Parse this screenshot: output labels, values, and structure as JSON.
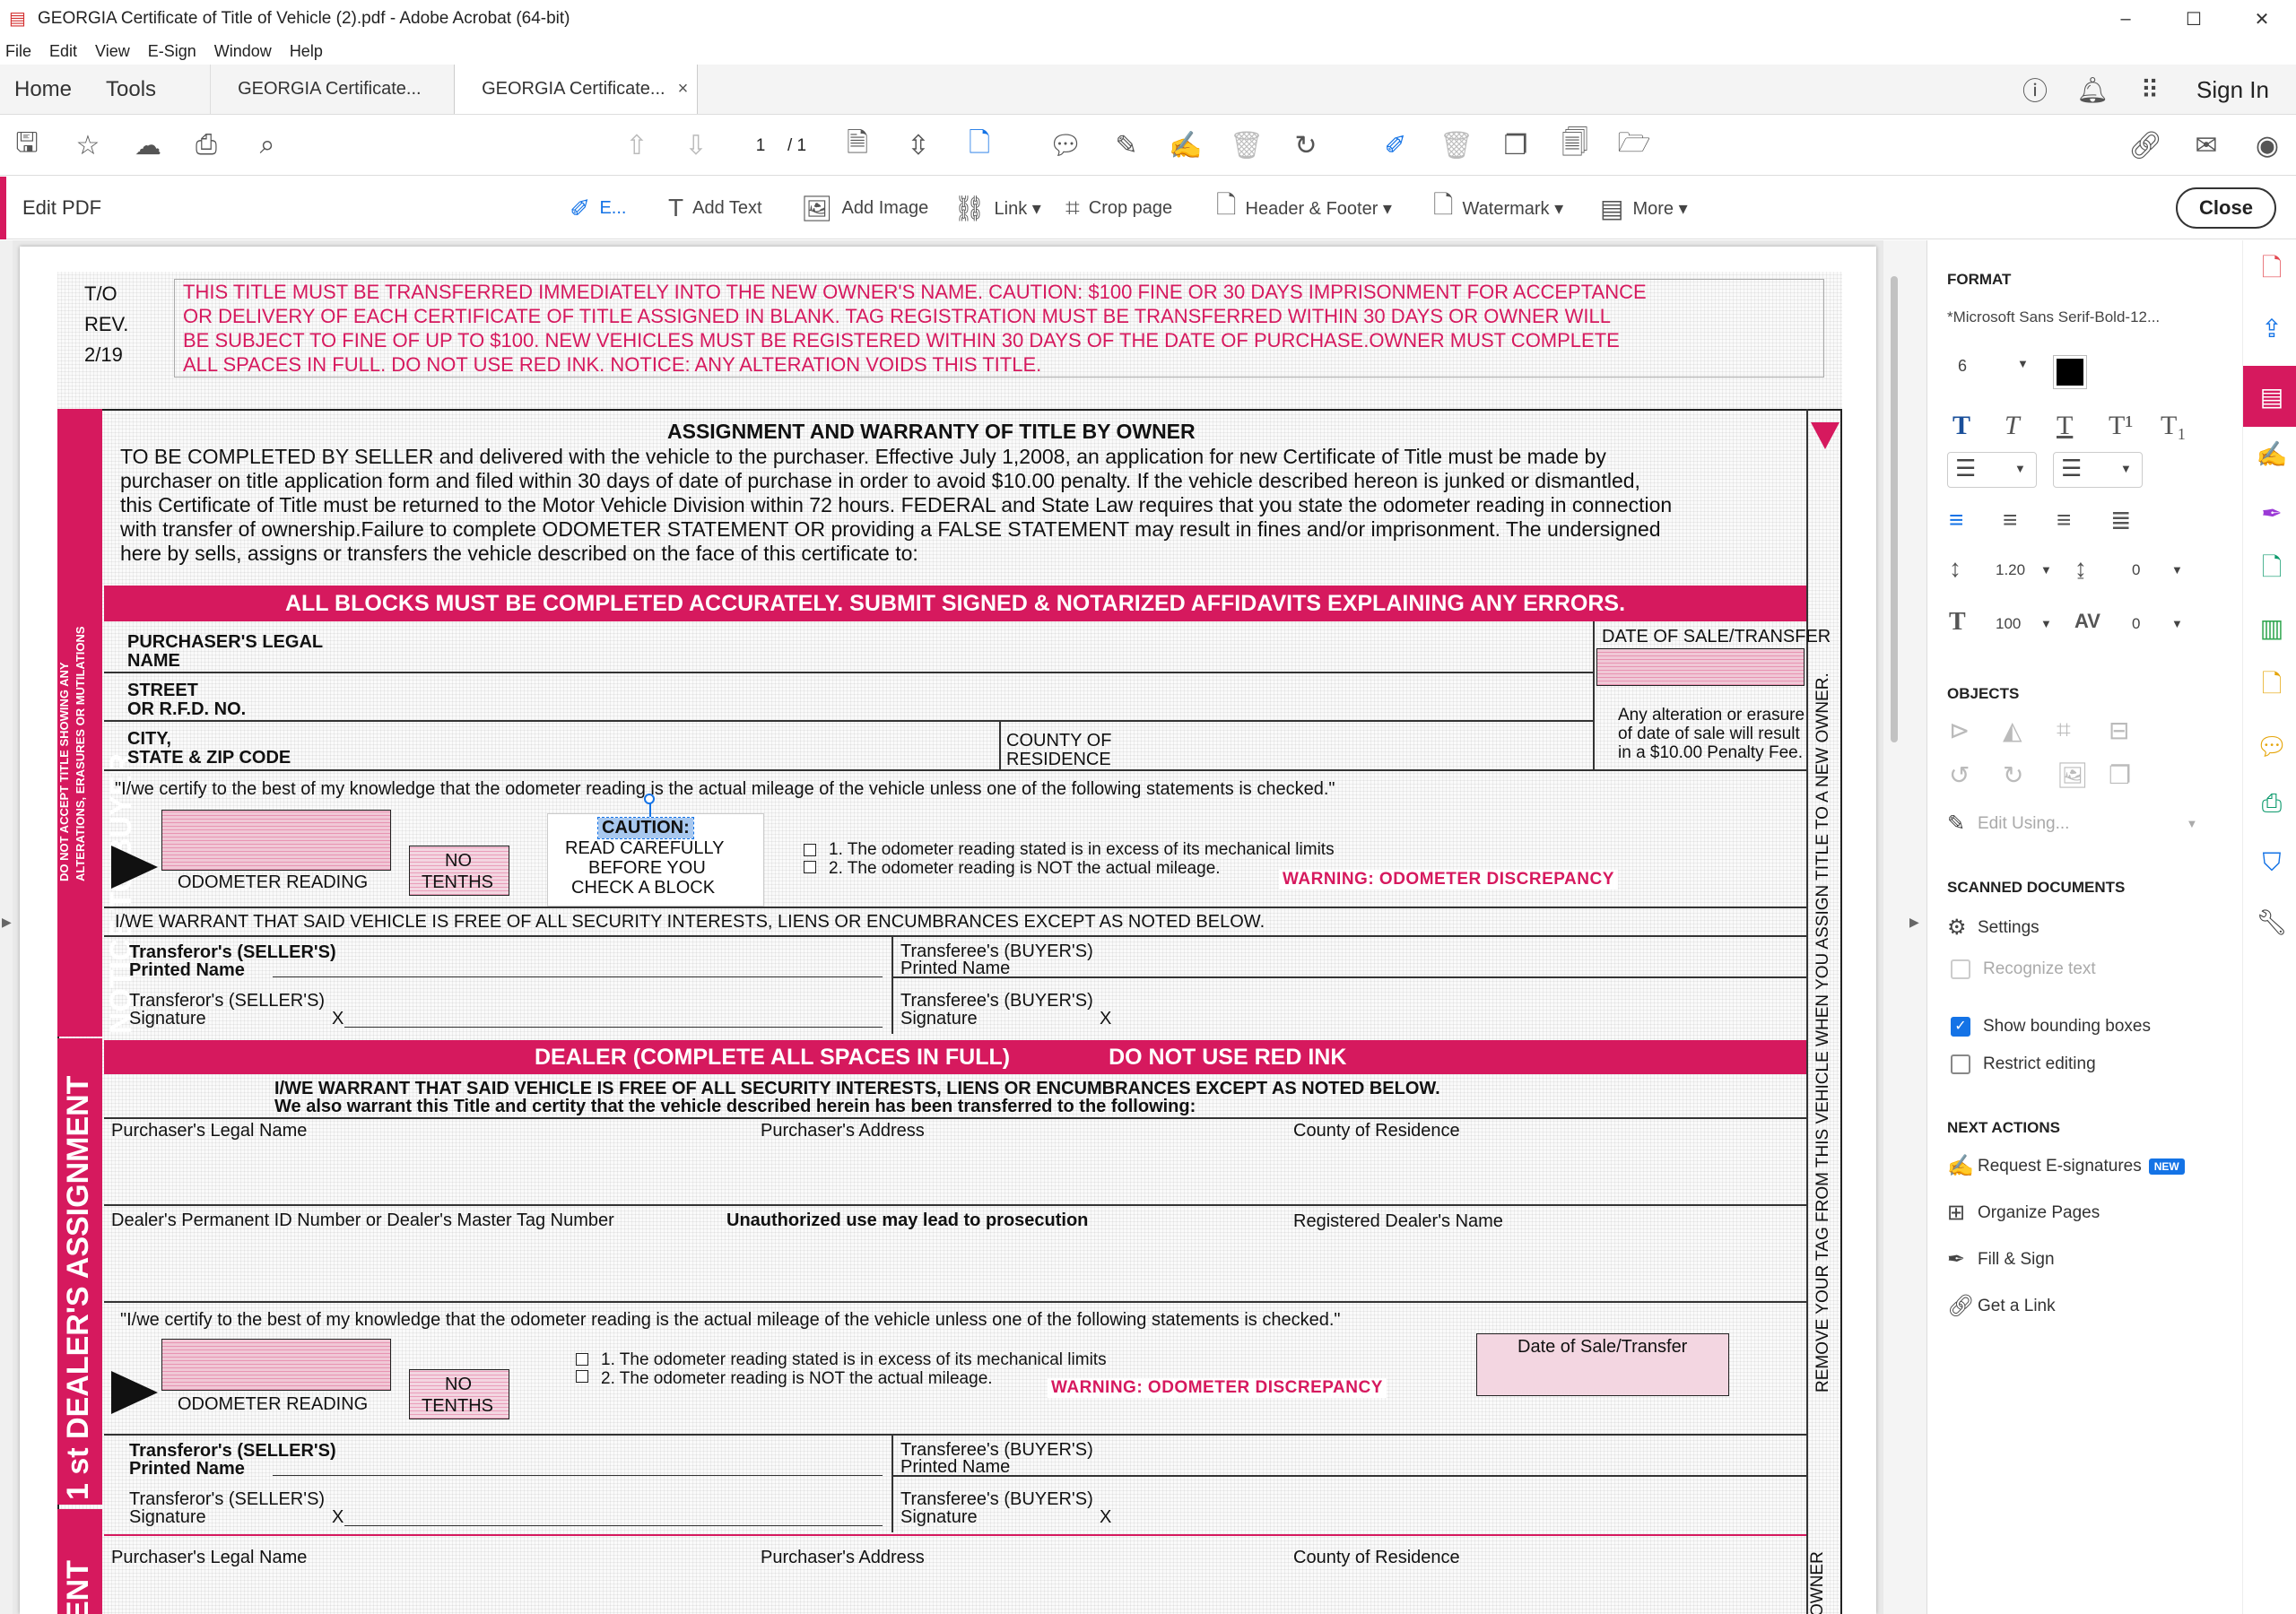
{
  "window": {
    "title": "GEORGIA Certificate of Title of Vehicle (2).pdf - Adobe Acrobat (64-bit)",
    "controls": [
      "–",
      "☐",
      "✕"
    ]
  },
  "menu": [
    "File",
    "Edit",
    "View",
    "E-Sign",
    "Window",
    "Help"
  ],
  "tabs": {
    "home": "Home",
    "tools": "Tools",
    "doc1": "GEORGIA Certificate...",
    "doc2": "GEORGIA Certificate...",
    "close_glyph": "×",
    "sign_in": "Sign In"
  },
  "toolbar": {
    "page_current": "1",
    "page_total": "/ 1"
  },
  "editbar": {
    "label": "Edit PDF",
    "edit": "E...",
    "add_text": "Add Text",
    "add_image": "Add Image",
    "link": "Link ▾",
    "crop": "Crop page",
    "header_footer": "Header & Footer ▾",
    "watermark": "Watermark ▾",
    "more": "More ▾",
    "close": "Close"
  },
  "document": {
    "to": "T/O",
    "rev": "REV.",
    "date": "2/19",
    "warning_lines": [
      "THIS TITLE MUST BE TRANSFERRED IMMEDIATELY INTO THE NEW OWNER'S NAME. CAUTION: $100 FINE OR 30 DAYS IMPRISONMENT FOR ACCEPTANCE",
      "OR DELIVERY OF EACH CERTIFICATE OF TITLE ASSIGNED IN BLANK. TAG REGISTRATION MUST BE TRANSFERRED WITHIN 30 DAYS OR OWNER WILL",
      "BE SUBJECT TO FINE OF UP TO $100. NEW VEHICLES MUST BE REGISTERED WITHIN 30 DAYS OF THE DATE OF PURCHASE.OWNER MUST COMPLETE",
      "ALL SPACES IN FULL. DO NOT USE RED INK. NOTICE: ANY ALTERATION VOIDS THIS TITLE."
    ],
    "assignment_title": "ASSIGNMENT AND WARRANTY OF TITLE BY OWNER",
    "assignment_lines": [
      "TO BE COMPLETED  BY SELLER  and delivered with the vehicle to the purchaser. Effective July 1,2008, an application for new Certificate of Title must be made by",
      "purchaser on title application form and filed within 30 days of date of purchase in order to avoid $10.00 penalty. If the vehicle described hereon is junked or dismantled,",
      "this Certificate of Title must be returned to the Motor Vehicle Division within 72 hours. FEDERAL and State Law requires that you state the odometer reading in connection",
      "with transfer of ownership.Failure to complete ODOMETER  STATEMENT OR providing a FALSE STATEMENT may result in fines and/or imprisonment. The undersigned",
      "here by sells, assigns or transfers the vehicle described on the face of this certificate to:"
    ],
    "side_small_1": "DO NOT ACCEPT TITLE SHOWING ANY",
    "side_small_2": "ALTERATIONS, ERASURES OR MUTILATIONS",
    "notice_to_buyer": "NOTICE TO BUYER",
    "all_blocks": "ALL BLOCKS MUST BE COMPLETED ACCURATELY. SUBMIT SIGNED & NOTARIZED AFFIDAVITS EXPLAINING ANY ERRORS.",
    "purchaser_legal_1": "PURCHASER'S LEGAL",
    "purchaser_legal_2": "NAME",
    "street_1": "STREET",
    "street_2": "OR R.F.D. NO.",
    "city_1": "CITY,",
    "city_2": "STATE & ZIP CODE",
    "county_1": "COUNTY OF",
    "county_2": "RESIDENCE",
    "date_of_sale": "DATE OF SALE/TRANSFER",
    "alteration_1": "Any alteration or erasure",
    "alteration_2": "of date of sale will result",
    "alteration_3": "in a $10.00 Penalty Fee.",
    "certify": "\"I/we certify to the best of my knowledge that the odometer reading is the actual mileage of the vehicle unless one of the following statements is checked.\"",
    "odometer_reading": "ODOMETER READING",
    "no": "NO",
    "tenths": "TENTHS",
    "caution": "CAUTION:",
    "read_carefully": "READ CAREFULLY",
    "before_you": "BEFORE YOU",
    "check_a_block": "CHECK A BLOCK",
    "stmt1": "1.  The odometer reading stated is in excess of its mechanical limits",
    "stmt2": "2.  The odometer reading is NOT the actual mileage.",
    "warning_odo": "WARNING: ODOMETER DISCREPANCY",
    "warrant": "I/WE WARRANT THAT SAID VEHICLE IS FREE OF ALL SECURITY INTERESTS, LIENS OR ENCUMBRANCES EXCEPT AS NOTED BELOW.",
    "transferor_printed_1": "Transferor's (SELLER'S)",
    "transferor_printed_2": "Printed Name",
    "transferor_sig_1": "Transferor's (SELLER'S)",
    "transferor_sig_2": "Signature",
    "transferee_printed_1": "Transferee's (BUYER'S)",
    "transferee_printed_2": "Printed Name",
    "transferee_sig_1": "Transferee's (BUYER'S)",
    "transferee_sig_2": "Signature",
    "x": "X",
    "dealer_band_1": "DEALER (COMPLETE ALL SPACES IN FULL)",
    "dealer_band_2": "DO NOT USE RED INK",
    "dealer_warrant_1": "I/WE WARRANT THAT SAID VEHICLE IS FREE OF ALL SECURITY INTERESTS, LIENS OR ENCUMBRANCES EXCEPT AS NOTED BELOW.",
    "dealer_warrant_2": "We also warrant this Title and certity that the vehicle described herein has been transferred to the following:",
    "purchasers_legal_name": "Purchaser's Legal Name",
    "purchasers_address": "Purchaser's Address",
    "county_of_residence": "County of Residence",
    "dealer_id": "Dealer's Permanent ID Number or Dealer's Master Tag Number",
    "unauthorized": "Unauthorized use may lead to prosecution",
    "registered_dealer": "Registered Dealer's Name",
    "date_sale_transfer_small": "Date of Sale/Transfer",
    "first_dealer": "1 st DEALER'S ASSIGNMENT",
    "bottom_ent": "ENT",
    "right_vertical": "REMOVE YOUR TAG FROM THIS VEHICLE WHEN YOU ASSIGN TITLE TO A NEW OWNER.",
    "right_vertical_2": "OWNER"
  },
  "panel": {
    "format": "FORMAT",
    "font": "*Microsoft Sans Serif-Bold-12...",
    "font_size": "6",
    "line_spacing": "1.20",
    "para_spacing": "0",
    "scale": "100",
    "char_spacing": "0",
    "objects": "OBJECTS",
    "edit_using": "Edit Using...",
    "scanned": "SCANNED DOCUMENTS",
    "settings": "Settings",
    "recognize": "Recognize text",
    "show_bounding": "Show bounding boxes",
    "restrict": "Restrict editing",
    "next_actions": "NEXT ACTIONS",
    "request_esig": "Request E-signatures",
    "new_badge": "NEW",
    "organize": "Organize Pages",
    "fill_sign": "Fill & Sign",
    "get_link": "Get a Link",
    "colors": {
      "accent": "#d6195e",
      "blue": "#1473e6",
      "swatch": "#000000"
    }
  }
}
